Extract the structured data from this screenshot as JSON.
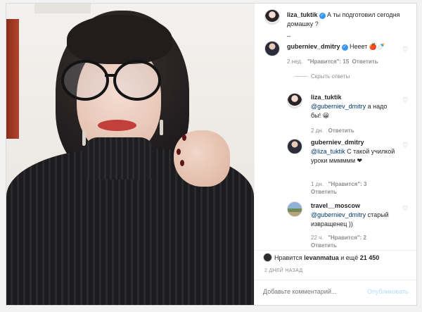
{
  "post": {
    "author": "liza_tuktik",
    "caption": "А ты подготовил сегодня домашку ?",
    "caption_extra": "_",
    "verified_mark": "✓"
  },
  "comments": [
    {
      "user": "guberniev_dmitry",
      "verified": true,
      "text": "Нееет 🍎🍼",
      "time": "2 нед.",
      "likes": "\"Нравится\": 15",
      "reply": "Ответить",
      "toggle": "Скрыть ответы"
    }
  ],
  "replies": [
    {
      "user": "liza_tuktik",
      "mention": "@guberniev_dmitry",
      "text": " а надо бы! 😀",
      "time": "2 дн.",
      "likes": "",
      "reply": "Ответить"
    },
    {
      "user": "guberniev_dmitry",
      "mention": "@liza_tuktik",
      "text": " С такой училкой уроки мммммм ❤",
      "time": "1 дн.",
      "likes": "\"Нравится\": 3",
      "reply": "Ответить"
    },
    {
      "user": "travel__moscow",
      "mention": "@guberniev_dmitry",
      "text": " старый извращенец ))",
      "time": "22 ч.",
      "likes": "\"Нравится\": 2",
      "reply": "Ответить"
    }
  ],
  "footer": {
    "likes_prefix": "Нравится ",
    "likes_user": "levanmatua",
    "likes_mid": " и ещё ",
    "likes_count": "21 450",
    "ago": "2 ДНЕЙ НАЗАД",
    "comment_placeholder": "Добавьте комментарий...",
    "publish": "Опубликовать"
  },
  "icons": {
    "heart": "heart-outline-icon"
  },
  "colors": {
    "accent": "#3897f0",
    "publish_disabled": "#b2dffc",
    "mention": "#00376b"
  }
}
